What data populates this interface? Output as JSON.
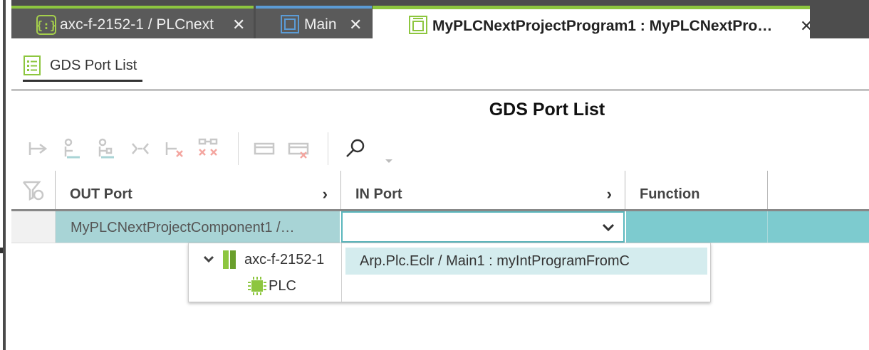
{
  "tabs": [
    {
      "label": "axc-f-2152-1 / PLCnext",
      "close": "✕"
    },
    {
      "label": "Main",
      "close": "✕"
    },
    {
      "label": "MyPLCNextProjectProgram1 : MyPLCNextPro…",
      "close": "✕"
    }
  ],
  "subtab": {
    "label": "GDS Port List"
  },
  "page": {
    "title": "GDS Port List"
  },
  "grid": {
    "columns": [
      {
        "label": "OUT Port",
        "chevron": "›"
      },
      {
        "label": "IN Port",
        "chevron": "›"
      },
      {
        "label": "Function"
      }
    ],
    "rows": [
      {
        "out_port": "MyPLCNextProjectComponent1 /…",
        "in_port": "",
        "function": ""
      }
    ]
  },
  "dropdown": {
    "tree": [
      {
        "label": "axc-f-2152-1",
        "expander": "⌄"
      },
      {
        "label": "PLC"
      }
    ],
    "items": [
      {
        "label": "Arp.Plc.Eclr / Main1 : myIntProgramFromC"
      }
    ]
  },
  "colors": {
    "accent_green": "#8dc63f",
    "accent_blue": "#5b9bd5",
    "row_selected": "#a8d4d6",
    "row_teal": "#7dcbcf",
    "list_highlight": "#d4ecee"
  }
}
